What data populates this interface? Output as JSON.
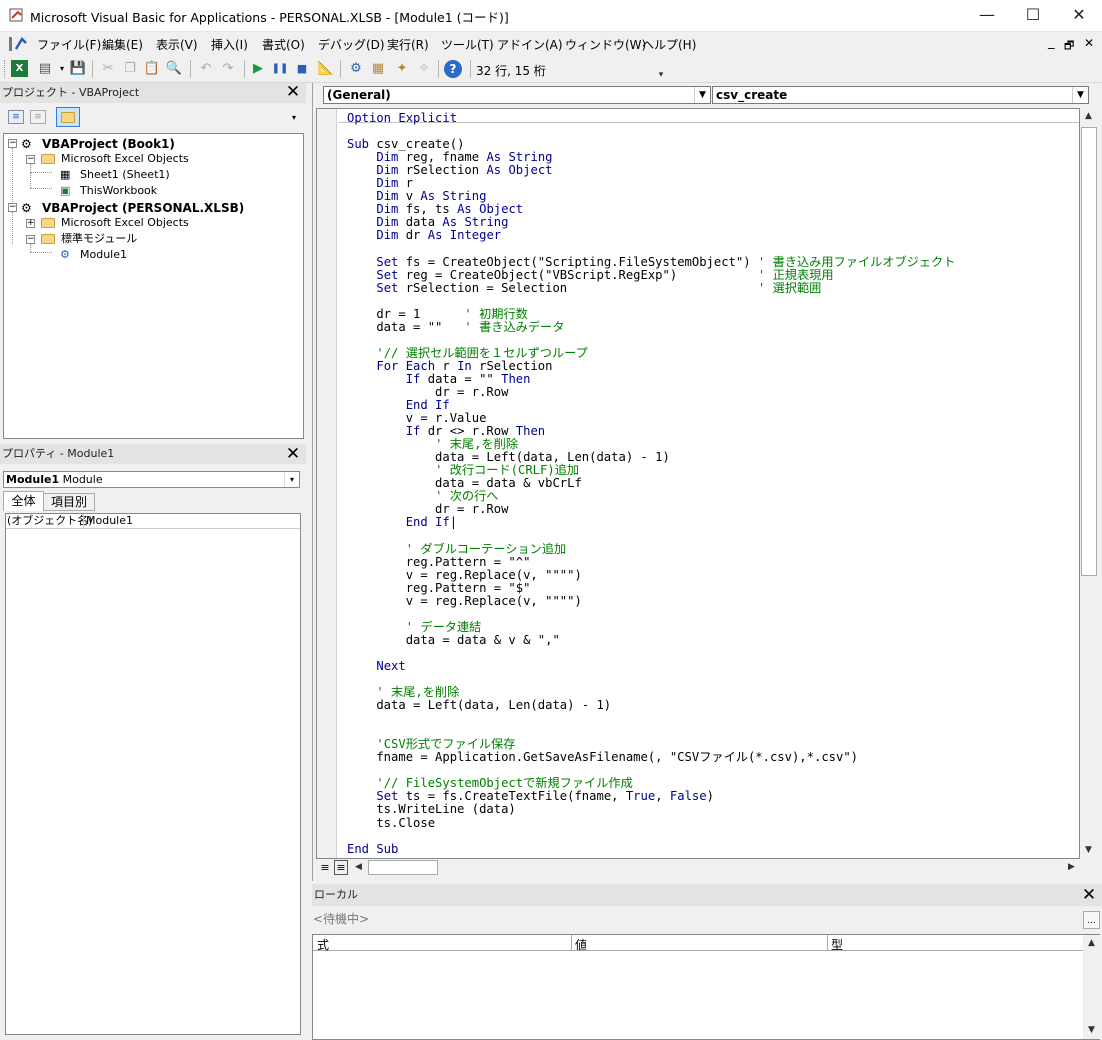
{
  "window": {
    "title": "Microsoft Visual Basic for Applications - PERSONAL.XLSB - [Module1 (コード)]",
    "minimize": "—",
    "maximize": "☐",
    "close": "✕"
  },
  "menu": [
    "ファイル(F)",
    "編集(E)",
    "表示(V)",
    "挿入(I)",
    "書式(O)",
    "デバッグ(D)",
    "実行(R)",
    "ツール(T)",
    "アドイン(A)",
    "ウィンドウ(W)",
    "ヘルプ(H)"
  ],
  "mdi_controls": {
    "minimize": "_",
    "restore": "🗗",
    "close": "✕"
  },
  "toolbar": {
    "position": "32 行, 15 桁"
  },
  "project_panel": {
    "title": "プロジェクト - VBAProject",
    "tree": [
      {
        "label": "VBAProject (Book1)",
        "bold": true
      },
      {
        "label": "Microsoft Excel Objects"
      },
      {
        "label": "Sheet1 (Sheet1)"
      },
      {
        "label": "ThisWorkbook"
      },
      {
        "label": "VBAProject (PERSONAL.XLSB)",
        "bold": true
      },
      {
        "label": "Microsoft Excel Objects"
      },
      {
        "label": "標準モジュール"
      },
      {
        "label": "Module1"
      }
    ]
  },
  "properties_panel": {
    "title": "プロパティ - Module1",
    "object_name": "Module1",
    "object_type": "Module",
    "tabs": [
      "全体",
      "項目別"
    ],
    "row_name": "(オブジェクト名)",
    "row_value": "Module1"
  },
  "code_window": {
    "object_combo": "(General)",
    "proc_combo": "csv_create",
    "lines": [
      {
        "t": "Option Explicit",
        "c": "kw"
      },
      {
        "t": ""
      },
      {
        "t": "Sub csv_create()",
        "c": "kwx"
      },
      {
        "t": "    Dim reg, fname As String",
        "c": "kw"
      },
      {
        "t": "    Dim rSelection As Object",
        "c": "kw"
      },
      {
        "t": "    Dim r",
        "c": "kw"
      },
      {
        "t": "    Dim v As String",
        "c": "kw"
      },
      {
        "t": "    Dim fs, ts As Object",
        "c": "kw"
      },
      {
        "t": "    Dim data As String",
        "c": "kw"
      },
      {
        "t": "    Dim dr As Integer",
        "c": "kw"
      },
      {
        "t": ""
      },
      {
        "t": "    Set fs = CreateObject(\"Scripting.FileSystemObject\") ",
        "k": "Set",
        "cmt": "' 書き込み用ファイルオブジェクト"
      },
      {
        "t": "    Set reg = CreateObject(\"VBScript.RegExp\")           ",
        "k": "Set",
        "cmt": "' 正規表現用"
      },
      {
        "t": "    Set rSelection = Selection                          ",
        "k": "Set",
        "cmt": "' 選択範囲"
      },
      {
        "t": ""
      },
      {
        "t": "    dr = 1      ",
        "cmt": "' 初期行数"
      },
      {
        "t": "    data = \"\"   ",
        "cmt": "' 書き込みデータ"
      },
      {
        "t": ""
      },
      {
        "t": "    ",
        "cmt": "'// 選択セル範囲を１セルずつループ"
      },
      {
        "t": "    For Each r In rSelection",
        "c": "kw"
      },
      {
        "t": "        If data = \"\" Then",
        "c": "kw"
      },
      {
        "t": "            dr = r.Row"
      },
      {
        "t": "        End If",
        "c": "kw"
      },
      {
        "t": "        v = r.Value"
      },
      {
        "t": "        If dr <> r.Row Then",
        "c": "kw"
      },
      {
        "t": "            ",
        "cmt": "' 末尾,を削除"
      },
      {
        "t": "            data = Left(data, Len(data) - 1)"
      },
      {
        "t": "            ",
        "cmt": "' 改行コード(CRLF)追加"
      },
      {
        "t": "            data = data & vbCrLf"
      },
      {
        "t": "            ",
        "cmt": "' 次の行へ"
      },
      {
        "t": "            dr = r.Row"
      },
      {
        "t": "        End If|",
        "c": "kw"
      },
      {
        "t": ""
      },
      {
        "t": "        ",
        "cmt": "' ダブルコーテーション追加"
      },
      {
        "t": "        reg.Pattern = \"^\""
      },
      {
        "t": "        v = reg.Replace(v, \"\"\"\")"
      },
      {
        "t": "        reg.Pattern = \"$\""
      },
      {
        "t": "        v = reg.Replace(v, \"\"\"\")"
      },
      {
        "t": ""
      },
      {
        "t": "        ",
        "cmt": "' データ連結"
      },
      {
        "t": "        data = data & v & \",\""
      },
      {
        "t": ""
      },
      {
        "t": "    Next",
        "c": "kw"
      },
      {
        "t": ""
      },
      {
        "t": "    ",
        "cmt": "' 末尾,を削除"
      },
      {
        "t": "    data = Left(data, Len(data) - 1)"
      },
      {
        "t": ""
      },
      {
        "t": ""
      },
      {
        "t": "    ",
        "cmt": "'CSV形式でファイル保存"
      },
      {
        "t": "    fname = Application.GetSaveAsFilename(, \"CSVファイル(*.csv),*.csv\")"
      },
      {
        "t": ""
      },
      {
        "t": "    ",
        "cmt": "'// FileSystemObjectで新規ファイル作成"
      },
      {
        "t": "    Set ts = fs.CreateTextFile(fname, True, False)",
        "k": "Set"
      },
      {
        "t": "    ts.WriteLine (data)"
      },
      {
        "t": "    ts.Close"
      },
      {
        "t": ""
      },
      {
        "t": "End Sub",
        "c": "kw"
      }
    ]
  },
  "locals_panel": {
    "title": "ローカル",
    "status": "<待機中>",
    "ellipsis": "...",
    "columns": [
      "式",
      "値",
      "型"
    ]
  },
  "colors": {
    "keyword": "#00008b",
    "comment": "#008000"
  }
}
